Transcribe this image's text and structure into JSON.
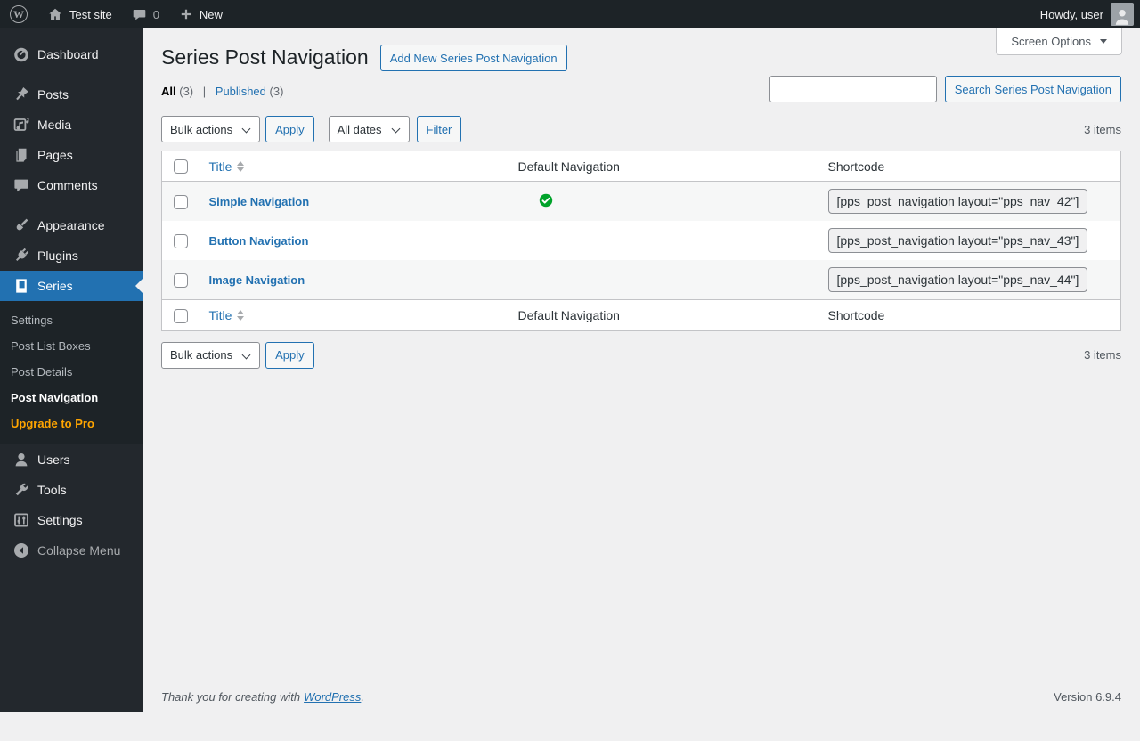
{
  "admin_bar": {
    "site_name": "Test site",
    "comments_count": "0",
    "new_label": "New",
    "howdy_label": "Howdy, user"
  },
  "sidebar": {
    "items": [
      {
        "label": "Dashboard"
      },
      {
        "label": "Posts"
      },
      {
        "label": "Media"
      },
      {
        "label": "Pages"
      },
      {
        "label": "Comments"
      },
      {
        "label": "Appearance"
      },
      {
        "label": "Plugins"
      },
      {
        "label": "Series"
      },
      {
        "label": "Users"
      },
      {
        "label": "Tools"
      },
      {
        "label": "Settings"
      },
      {
        "label": "Collapse Menu"
      }
    ],
    "series_submenu": [
      {
        "label": "Settings"
      },
      {
        "label": "Post List Boxes"
      },
      {
        "label": "Post Details"
      },
      {
        "label": "Post Navigation"
      },
      {
        "label": "Upgrade to Pro"
      }
    ]
  },
  "page": {
    "title": "Series Post Navigation",
    "add_new_button": "Add New Series Post Navigation",
    "screen_options": "Screen Options",
    "views": {
      "all": "All",
      "all_count": "(3)",
      "separator": "|",
      "published": "Published",
      "published_count": "(3)"
    },
    "search_button": "Search Series Post Navigation",
    "toolbar": {
      "bulk_actions": "Bulk actions",
      "apply": "Apply",
      "all_dates": "All dates",
      "filter": "Filter"
    },
    "items_count": "3 items"
  },
  "table": {
    "headers": {
      "title": "Title",
      "default_navigation": "Default Navigation",
      "shortcode": "Shortcode"
    },
    "rows": [
      {
        "title": "Simple Navigation",
        "is_default": true,
        "shortcode": "[pps_post_navigation layout=\"pps_nav_42\"]"
      },
      {
        "title": "Button Navigation",
        "is_default": false,
        "shortcode": "[pps_post_navigation layout=\"pps_nav_43\"]"
      },
      {
        "title": "Image Navigation",
        "is_default": false,
        "shortcode": "[pps_post_navigation layout=\"pps_nav_44\"]"
      }
    ]
  },
  "footer": {
    "thanks_text": "Thank you for creating with",
    "wordpress_link": "WordPress",
    "period": ".",
    "version": "Version 6.9.4"
  },
  "colors": {
    "accent_blue": "#2271b1",
    "success_green": "#00a32a",
    "upgrade_orange": "#ffa500",
    "adminbar_bg": "#1d2327",
    "menu_bg": "#23282d",
    "submenu_bg": "#1d2327",
    "content_bg": "#f0f0f1"
  }
}
